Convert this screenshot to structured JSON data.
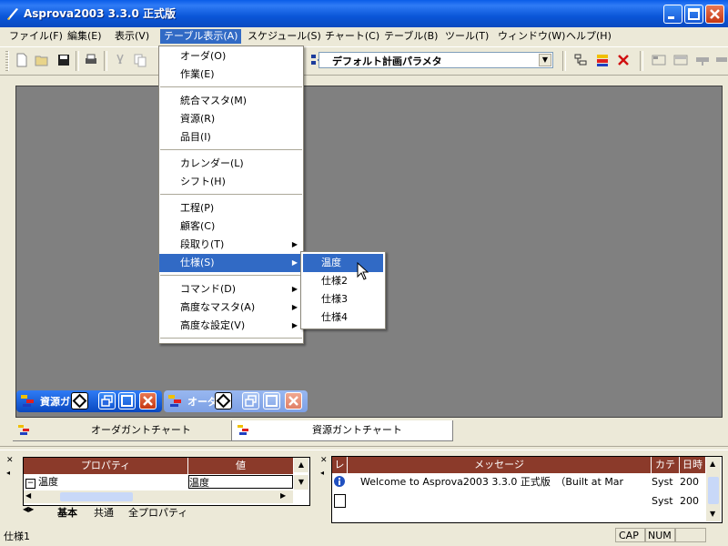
{
  "window": {
    "title": "Asprova2003 3.3.0 正式版",
    "controls": {
      "minimize": "minimize",
      "maximize": "maximize",
      "close": "close"
    }
  },
  "menubar": {
    "items": [
      {
        "label": "ファイル(F)"
      },
      {
        "label": "編集(E)"
      },
      {
        "label": "表示(V)"
      },
      {
        "label": "テーブル表示(A)",
        "active": true
      },
      {
        "label": "スケジュール(S)"
      },
      {
        "label": "チャート(C)"
      },
      {
        "label": "テーブル(B)"
      },
      {
        "label": "ツール(T)"
      },
      {
        "label": "ウィンドウ(W)"
      },
      {
        "label": "ヘルプ(H)"
      }
    ]
  },
  "toolbar": {
    "combo_value": "デフォルト計画パラメタ"
  },
  "table_menu": {
    "groups": [
      [
        "オーダ(O)",
        "作業(E)"
      ],
      [
        "統合マスタ(M)",
        "資源(R)",
        "品目(I)"
      ],
      [
        "カレンダー(L)",
        "シフト(H)"
      ],
      [
        "工程(P)",
        "顧客(C)",
        "段取り(T)",
        "仕様(S)"
      ],
      [
        "コマンド(D)",
        "高度なマスタ(A)",
        "高度な設定(V)"
      ]
    ],
    "highlighted": "仕様(S)"
  },
  "spec_submenu": {
    "items": [
      "温度",
      "仕様2",
      "仕様3",
      "仕様4"
    ],
    "highlighted": "温度"
  },
  "minimized_windows": [
    {
      "label": "資源ガ"
    },
    {
      "label": "オーダ"
    }
  ],
  "tabs": [
    {
      "label": "オーダガントチャート"
    },
    {
      "label": "資源ガントチャート",
      "active": true
    }
  ],
  "property_panel": {
    "headers": [
      "プロパティ",
      "値"
    ],
    "rows": [
      {
        "name": "温度",
        "value": "温度"
      }
    ],
    "tabs": [
      "基本",
      "共通",
      "全プロパティ"
    ]
  },
  "message_panel": {
    "headers": [
      "レ",
      "メッセージ",
      "カテ",
      "日時"
    ],
    "rows": [
      {
        "message": "Welcome to Asprova2003 3.3.0 正式版　（Built at Mar",
        "category": "Syst",
        "time": "200"
      },
      {
        "message": "",
        "category": "Syst",
        "time": "200"
      }
    ]
  },
  "statusbar": {
    "text": "仕様1",
    "cap": "CAP",
    "num": "NUM"
  }
}
